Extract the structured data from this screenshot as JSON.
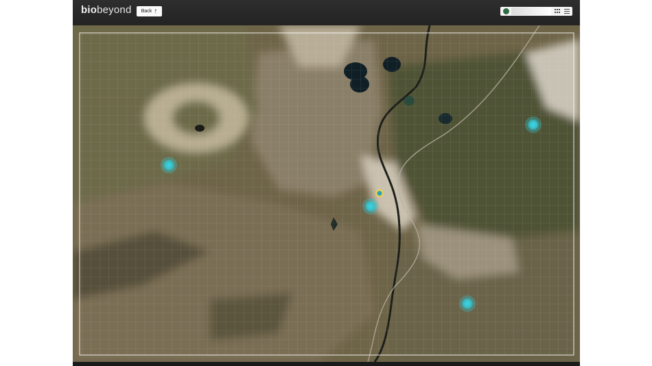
{
  "header": {
    "logo_bold": "bio",
    "logo_light": "beyond",
    "back_label": "Back",
    "back_icon": "arrow-up-icon"
  },
  "search": {
    "value": "",
    "placeholder": "",
    "icons": [
      "globe-icon",
      "grid-view-icon",
      "list-view-icon"
    ]
  },
  "map": {
    "view": "satellite",
    "grid_overlay": true,
    "marker_color": "#35c3cf",
    "markers": [
      {
        "id": "site-1"
      },
      {
        "id": "site-2"
      },
      {
        "id": "site-3"
      },
      {
        "id": "site-4"
      },
      {
        "id": "site-5"
      }
    ]
  },
  "colors": {
    "toolbar": "#262626",
    "accent": "#35c3cf"
  }
}
